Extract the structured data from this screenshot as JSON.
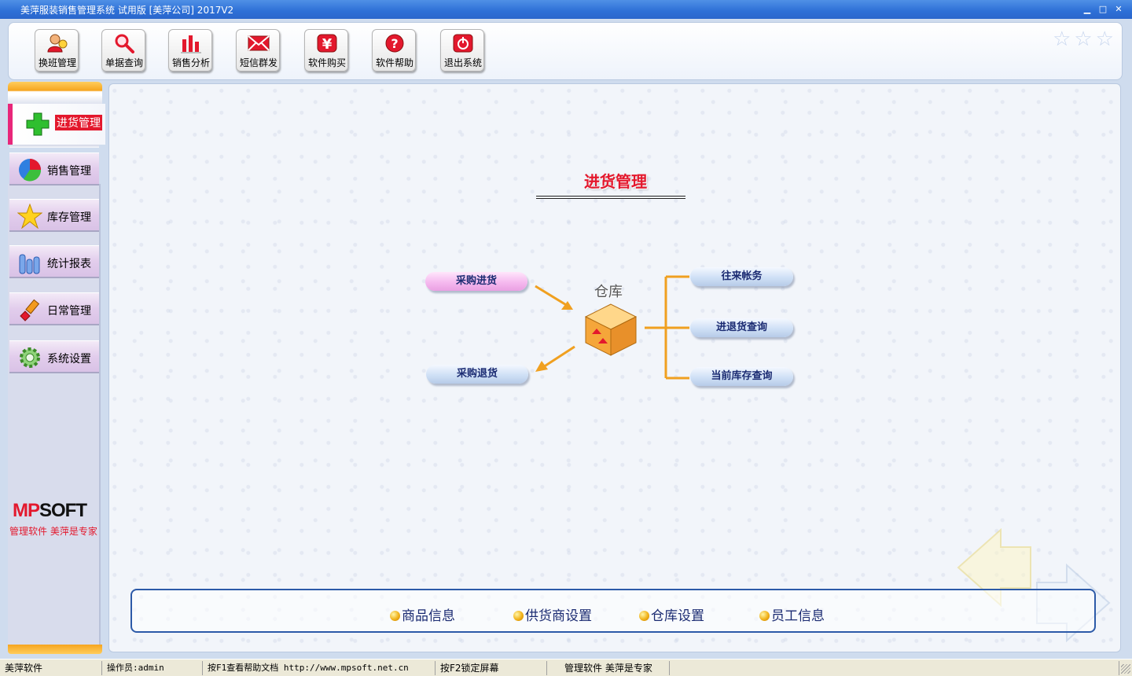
{
  "window": {
    "title": "美萍服装销售管理系统 试用版 [美萍公司] 2017V2",
    "minimize": "▁",
    "maximize": "□",
    "close": "✕"
  },
  "toolbar": {
    "buttons": [
      {
        "label": "换班管理",
        "icon": "user-switch-icon"
      },
      {
        "label": "单据查询",
        "icon": "magnifier-icon"
      },
      {
        "label": "销售分析",
        "icon": "bar-chart-icon"
      },
      {
        "label": "短信群发",
        "icon": "envelope-icon"
      },
      {
        "label": "软件购买",
        "icon": "yen-icon"
      },
      {
        "label": "软件帮助",
        "icon": "question-icon"
      },
      {
        "label": "退出系统",
        "icon": "power-icon"
      }
    ]
  },
  "sidebar": {
    "active": {
      "label": "进货管理",
      "icon": "green-plus-icon"
    },
    "items": [
      {
        "label": "销售管理",
        "icon": "pie-chart-icon"
      },
      {
        "label": "库存管理",
        "icon": "star-icon"
      },
      {
        "label": "统计报表",
        "icon": "bar-stats-icon"
      },
      {
        "label": "日常管理",
        "icon": "brush-icon"
      },
      {
        "label": "系统设置",
        "icon": "gear-icon"
      }
    ],
    "logo_mp": "MP",
    "logo_soft": "SOFT",
    "tagline": "管理软件 美萍是专家"
  },
  "main": {
    "heading": "进货管理",
    "warehouse_label": "仓库",
    "left_actions": [
      "采购进货",
      "采购退货"
    ],
    "right_actions": [
      "往来帐务",
      "进退货查询",
      "当前库存查询"
    ],
    "bottom_links": [
      "商品信息",
      "供货商设置",
      "仓库设置",
      "员工信息"
    ]
  },
  "statusbar": {
    "cells": [
      "美萍软件",
      "操作员:admin",
      "按F1查看帮助文档  http://www.mpsoft.net.cn",
      "按F2锁定屏幕",
      "管理软件 美萍是专家"
    ]
  },
  "colors": {
    "title_bar": "#2d6fd6",
    "accent_red": "#e3182d",
    "accent_orange": "#f0a020",
    "active_marker": "#e8267a",
    "link_blue": "#1b2b72"
  }
}
